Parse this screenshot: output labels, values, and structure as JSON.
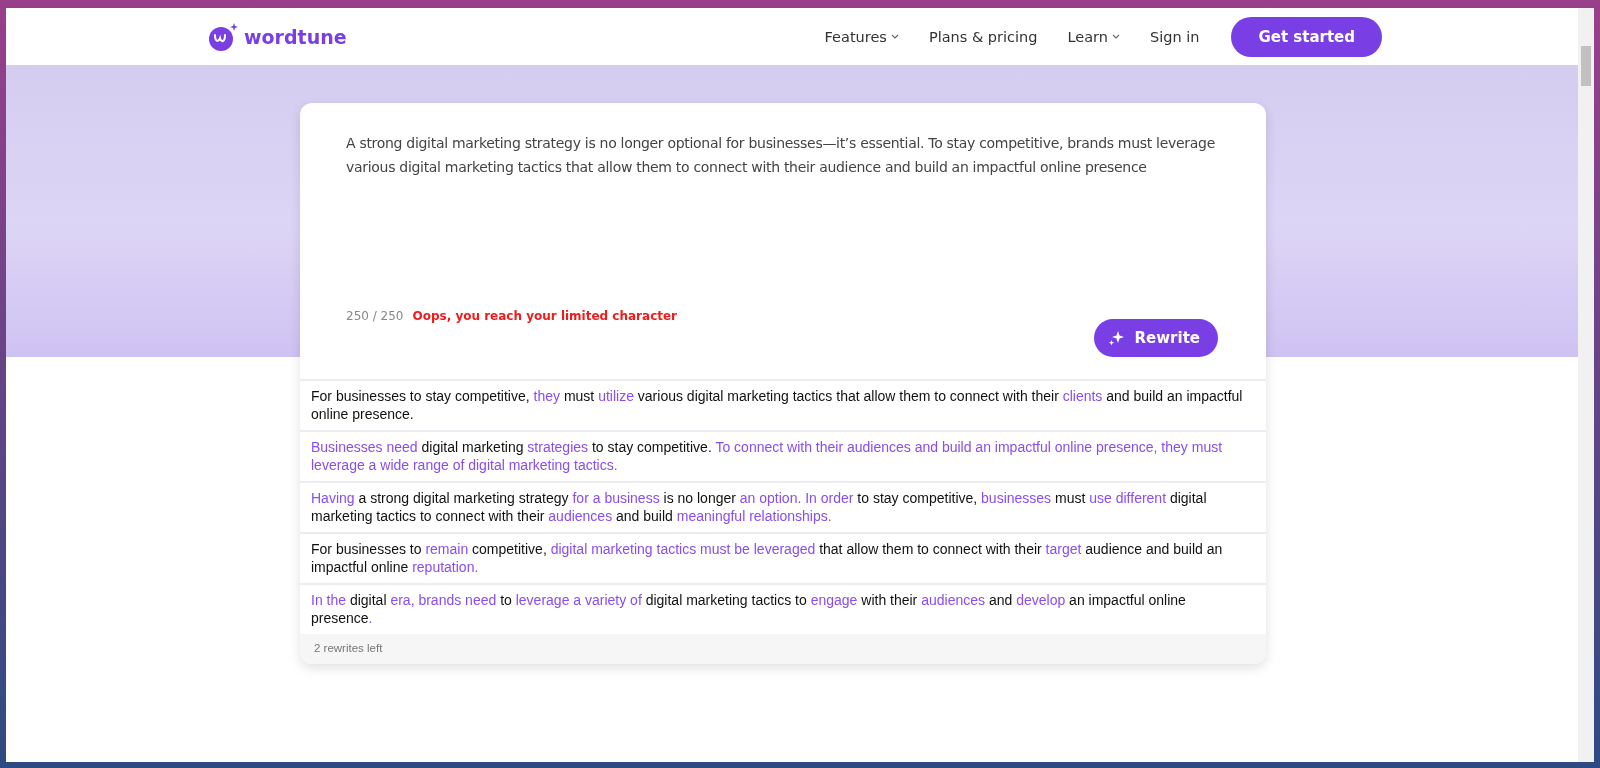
{
  "header": {
    "logo": "wordtune",
    "nav": [
      {
        "label": "Features",
        "dropdown": true
      },
      {
        "label": "Plans & pricing",
        "dropdown": false
      },
      {
        "label": "Learn",
        "dropdown": true
      },
      {
        "label": "Sign in",
        "dropdown": false
      }
    ],
    "cta": "Get started"
  },
  "editor": {
    "text": "A strong digital marketing strategy is no longer optional for businesses—it’s essential. To stay competitive, brands must leverage various digital marketing tactics that allow them to connect with their audience and build an impactful online presence",
    "counter": "250 / 250",
    "warning": "Oops, you reach your limited character",
    "button": "Rewrite"
  },
  "rewrites": [
    [
      {
        "text": "For businesses to stay competitive, ",
        "changed": false
      },
      {
        "text": "they",
        "changed": true
      },
      {
        "text": " must ",
        "changed": false
      },
      {
        "text": "utilize",
        "changed": true
      },
      {
        "text": " various digital marketing tactics that allow them to connect with their ",
        "changed": false
      },
      {
        "text": "clients",
        "changed": true
      },
      {
        "text": " and build an impactful online presence.",
        "changed": false
      }
    ],
    [
      {
        "text": "Businesses need",
        "changed": true
      },
      {
        "text": " digital marketing ",
        "changed": false
      },
      {
        "text": "strategies",
        "changed": true
      },
      {
        "text": " to stay competitive. ",
        "changed": false
      },
      {
        "text": "To connect with their audiences and build an impactful online presence, they must leverage a wide range of digital marketing tactics.",
        "changed": true
      }
    ],
    [
      {
        "text": "Having",
        "changed": true
      },
      {
        "text": " a strong digital marketing strategy ",
        "changed": false
      },
      {
        "text": "for a business",
        "changed": true
      },
      {
        "text": " is no longer ",
        "changed": false
      },
      {
        "text": "an option. In order",
        "changed": true
      },
      {
        "text": " to stay competitive, ",
        "changed": false
      },
      {
        "text": "businesses",
        "changed": true
      },
      {
        "text": " must ",
        "changed": false
      },
      {
        "text": "use different",
        "changed": true
      },
      {
        "text": " digital marketing tactics to connect with their ",
        "changed": false
      },
      {
        "text": "audiences",
        "changed": true
      },
      {
        "text": " and build ",
        "changed": false
      },
      {
        "text": "meaningful relationships.",
        "changed": true
      }
    ],
    [
      {
        "text": "For businesses to ",
        "changed": false
      },
      {
        "text": "remain",
        "changed": true
      },
      {
        "text": " competitive, ",
        "changed": false
      },
      {
        "text": "digital marketing tactics must be leveraged",
        "changed": true
      },
      {
        "text": " that allow them to connect with their ",
        "changed": false
      },
      {
        "text": "target",
        "changed": true
      },
      {
        "text": " audience and build an impactful online ",
        "changed": false
      },
      {
        "text": "reputation.",
        "changed": true
      }
    ],
    [
      {
        "text": "In the",
        "changed": true
      },
      {
        "text": " digital ",
        "changed": false
      },
      {
        "text": "era, brands need",
        "changed": true
      },
      {
        "text": " to ",
        "changed": false
      },
      {
        "text": "leverage a variety of",
        "changed": true
      },
      {
        "text": " digital marketing tactics to ",
        "changed": false
      },
      {
        "text": "engage",
        "changed": true
      },
      {
        "text": " with their ",
        "changed": false
      },
      {
        "text": "audiences",
        "changed": true
      },
      {
        "text": " and ",
        "changed": false
      },
      {
        "text": "develop",
        "changed": true
      },
      {
        "text": " an impactful online presence",
        "changed": false
      },
      {
        "text": ".",
        "changed": true
      }
    ]
  ],
  "footer": "2 rewrites left"
}
